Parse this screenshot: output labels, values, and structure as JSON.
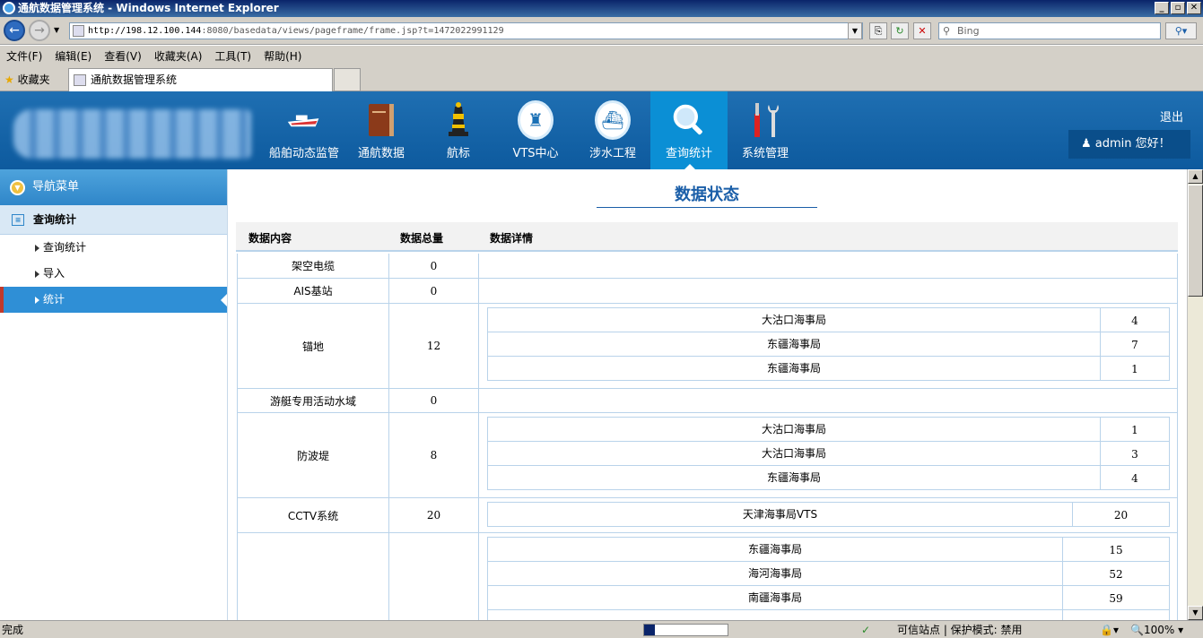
{
  "window": {
    "title": "通航数据管理系统 - Windows Internet Explorer"
  },
  "address": {
    "url_host": "http://198.12.100.144",
    "url_rest": ":8080/basedata/views/pageframe/frame.jsp?t=1472022991129",
    "search_placeholder": "Bing"
  },
  "menu": {
    "items": [
      "文件(F)",
      "编辑(E)",
      "查看(V)",
      "收藏夹(A)",
      "工具(T)",
      "帮助(H)"
    ]
  },
  "favorites": {
    "label": "收藏夹",
    "tab_title": "通航数据管理系统"
  },
  "header": {
    "nav": [
      {
        "label": "船舶动态监管",
        "icon": "ship-icon"
      },
      {
        "label": "通航数据",
        "icon": "book-icon"
      },
      {
        "label": "航标",
        "icon": "beacon-icon"
      },
      {
        "label": "VTS中心",
        "icon": "vts-tower-icon"
      },
      {
        "label": "涉水工程",
        "icon": "water-engineering-icon"
      },
      {
        "label": "查询统计",
        "icon": "magnifier-icon"
      },
      {
        "label": "系统管理",
        "icon": "tools-icon"
      }
    ],
    "logout": "退出",
    "user_greeting": "admin  您好！"
  },
  "sidebar": {
    "title": "导航菜单",
    "section": "查询统计",
    "items": [
      "查询统计",
      "导入",
      "统计"
    ]
  },
  "main": {
    "title": "数据状态",
    "columns": [
      "数据内容",
      "数据总量",
      "数据详情"
    ],
    "rows": [
      {
        "name": "架空电缆",
        "total": "0",
        "details": []
      },
      {
        "name": "AIS基站",
        "total": "0",
        "details": []
      },
      {
        "name": "锚地",
        "total": "12",
        "details": [
          {
            "name": "大沽口海事局",
            "count": "4"
          },
          {
            "name": "东疆海事局",
            "count": "7"
          },
          {
            "name": "东疆海事局",
            "count": "1"
          }
        ]
      },
      {
        "name": "游艇专用活动水域",
        "total": "0",
        "details": []
      },
      {
        "name": "防波堤",
        "total": "8",
        "details": [
          {
            "name": "大沽口海事局",
            "count": "1"
          },
          {
            "name": "大沽口海事局",
            "count": "3"
          },
          {
            "name": "东疆海事局",
            "count": "4"
          }
        ]
      },
      {
        "name": "CCTV系统",
        "total": "20",
        "details": [
          {
            "name": "天津海事局VTS",
            "count": "20"
          }
        ]
      },
      {
        "name": "",
        "total": "",
        "details": [
          {
            "name": "东疆海事局",
            "count": "15"
          },
          {
            "name": "海河海事局",
            "count": "52"
          },
          {
            "name": "南疆海事局",
            "count": "59"
          }
        ]
      }
    ]
  },
  "status": {
    "left": "完成",
    "zone": "可信站点 | 保护模式: 禁用",
    "zoom": "100%"
  }
}
